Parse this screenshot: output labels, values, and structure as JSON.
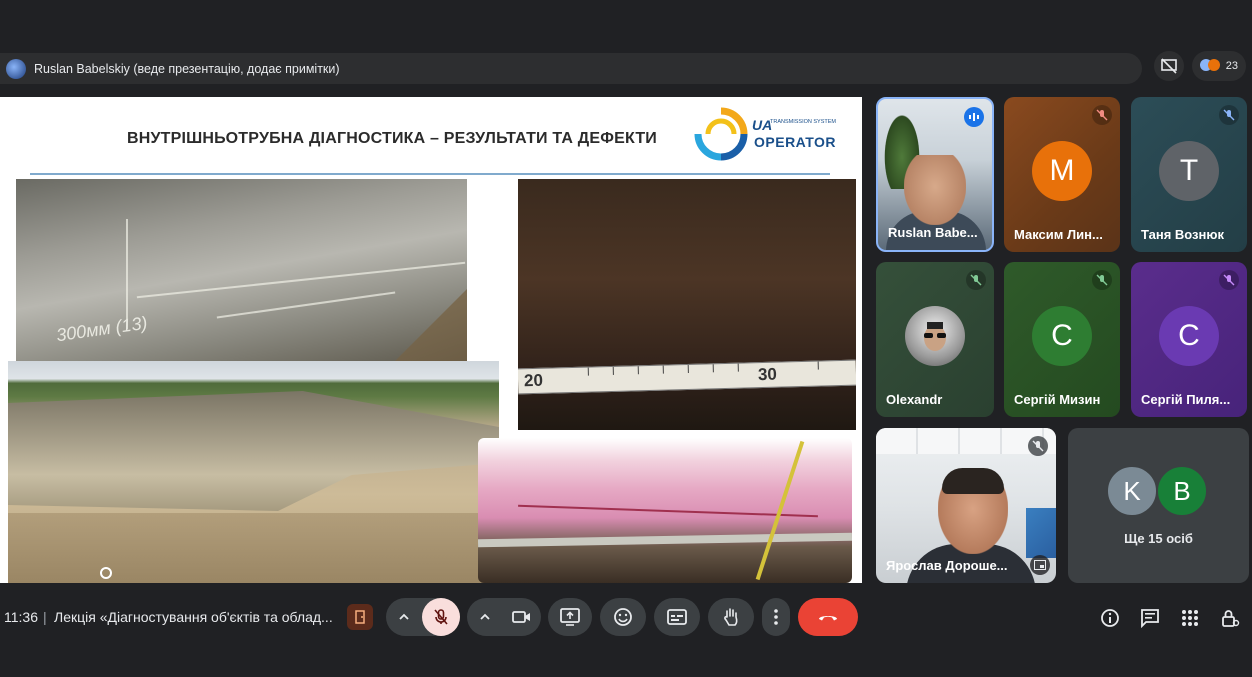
{
  "banner": {
    "presenter_text": "Ruslan Babelskiy (веде презентацію, додає примітки)"
  },
  "top_right": {
    "participant_count": "23"
  },
  "slide": {
    "title": "ВНУТРІШНЬОТРУБНА ДІАГНОСТИКА – РЕЗУЛЬТАТИ ТА ДЕФЕКТИ",
    "logo": {
      "line1": "UA",
      "line2": "TRANSMISSION SYSTEM",
      "line3": "OPERATOR"
    },
    "photo1_scribble": "300мм (13)",
    "tape_numbers": [
      "20",
      "30"
    ]
  },
  "participants": [
    {
      "name": "Ruslan Babe...",
      "mic": "speaking"
    },
    {
      "name": "Максим Лин...",
      "initial": "М",
      "avatar_color": "#e8710a",
      "mic": "muted"
    },
    {
      "name": "Таня Вознюк",
      "initial": "Т",
      "avatar_color": "#5f6368",
      "mic": "muted"
    },
    {
      "name": "Olexandr",
      "mic": "muted"
    },
    {
      "name": "Сергій Мизин",
      "initial": "С",
      "avatar_color": "#2e7d32",
      "mic": "muted"
    },
    {
      "name": "Сергій Пиля...",
      "initial": "С",
      "avatar_color": "#6a3ab2",
      "mic": "muted"
    },
    {
      "name": "Ярослав Дороше...",
      "mic": "muted"
    }
  ],
  "more_tile": {
    "avatars": [
      {
        "initial": "K",
        "color": "#7b8a95"
      },
      {
        "initial": "B",
        "color": "#188038"
      }
    ],
    "label": "Ще 15 осіб"
  },
  "bottom": {
    "time": "11:36",
    "separator": "|",
    "meeting_title": "Лекція «Діагностування об'єктів та облад...",
    "icons": [
      "info-icon",
      "chat-icon",
      "apps-icon",
      "host-controls-icon"
    ]
  },
  "colors": {
    "background": "#202124",
    "end_call": "#ea4335",
    "mic_off_bg": "#f9dedc",
    "tile_border_active": "#8ab4f8"
  }
}
